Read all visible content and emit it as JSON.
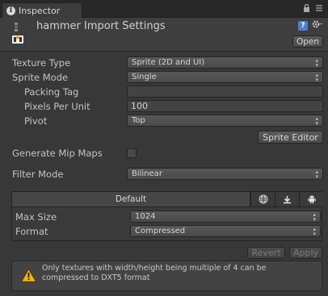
{
  "tab": {
    "title": "Inspector",
    "icons": [
      "lock-icon",
      "menu-icon"
    ]
  },
  "header": {
    "title": "hammer Import Settings",
    "open_label": "Open",
    "icons": [
      "help-book-icon",
      "gear-icon"
    ]
  },
  "settings": {
    "texture_type_label": "Texture Type",
    "texture_type_value": "Sprite (2D and UI)",
    "sprite_mode_label": "Sprite Mode",
    "sprite_mode_value": "Single",
    "packing_tag_label": "Packing Tag",
    "packing_tag_value": "",
    "pixels_per_unit_label": "Pixels Per Unit",
    "pixels_per_unit_value": "100",
    "pivot_label": "Pivot",
    "pivot_value": "Top",
    "sprite_editor_label": "Sprite Editor",
    "generate_mip_maps_label": "Generate Mip Maps",
    "generate_mip_maps_checked": false,
    "filter_mode_label": "Filter Mode",
    "filter_mode_value": "Bilinear"
  },
  "platform": {
    "default_label": "Default",
    "icons": [
      "globe-icon",
      "download-icon",
      "android-icon"
    ],
    "max_size_label": "Max Size",
    "max_size_value": "1024",
    "format_label": "Format",
    "format_value": "Compressed"
  },
  "actions": {
    "revert_label": "Revert",
    "apply_label": "Apply"
  },
  "helpbox": {
    "text": "Only textures with width/height being multiple of 4 can be compressed to DXT5 format"
  },
  "colors": {
    "background": "#383838",
    "warning": "#f0b400",
    "accent": "#4e7fd1"
  }
}
